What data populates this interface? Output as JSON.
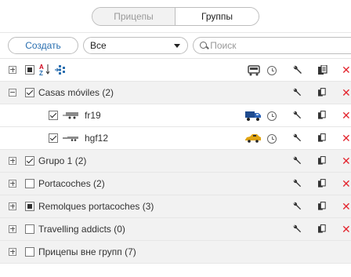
{
  "tabs": [
    {
      "label": "Прицепы",
      "active": false
    },
    {
      "label": "Группы",
      "active": true
    }
  ],
  "toolbar": {
    "create_label": "Создать",
    "filter_value": "Все",
    "search_placeholder": "Поиск"
  },
  "header_icons": [
    "expand-all-icon",
    "select-all-icon",
    "sort-az-icon",
    "group-settings-icon",
    "vehicle-icon",
    "history-clock-icon",
    "wrench-icon",
    "copy-icon",
    "delete-icon"
  ],
  "rows": [
    {
      "label": "Casas móviles (2)",
      "type": "group",
      "expanded": true,
      "checked": "checked"
    },
    {
      "label": "fr19",
      "type": "unit",
      "checked": "checked"
    },
    {
      "label": "hgf12",
      "type": "unit",
      "checked": "checked"
    },
    {
      "label": "Grupo 1 (2)",
      "type": "group",
      "expanded": false,
      "checked": "checked"
    },
    {
      "label": "Portacoches (2)",
      "type": "group",
      "expanded": false,
      "checked": "unchecked"
    },
    {
      "label": "Remolques portacoches (3)",
      "type": "group",
      "expanded": false,
      "checked": "partial"
    },
    {
      "label": "Travelling addicts (0)",
      "type": "group",
      "expanded": false,
      "checked": "unchecked"
    },
    {
      "label": "Прицепы вне групп (7)",
      "type": "group",
      "expanded": false,
      "checked": "unchecked"
    }
  ],
  "colors": {
    "accent": "#2a6fb0",
    "delete": "#e3262f",
    "group_bg": "#f2f2f2"
  }
}
